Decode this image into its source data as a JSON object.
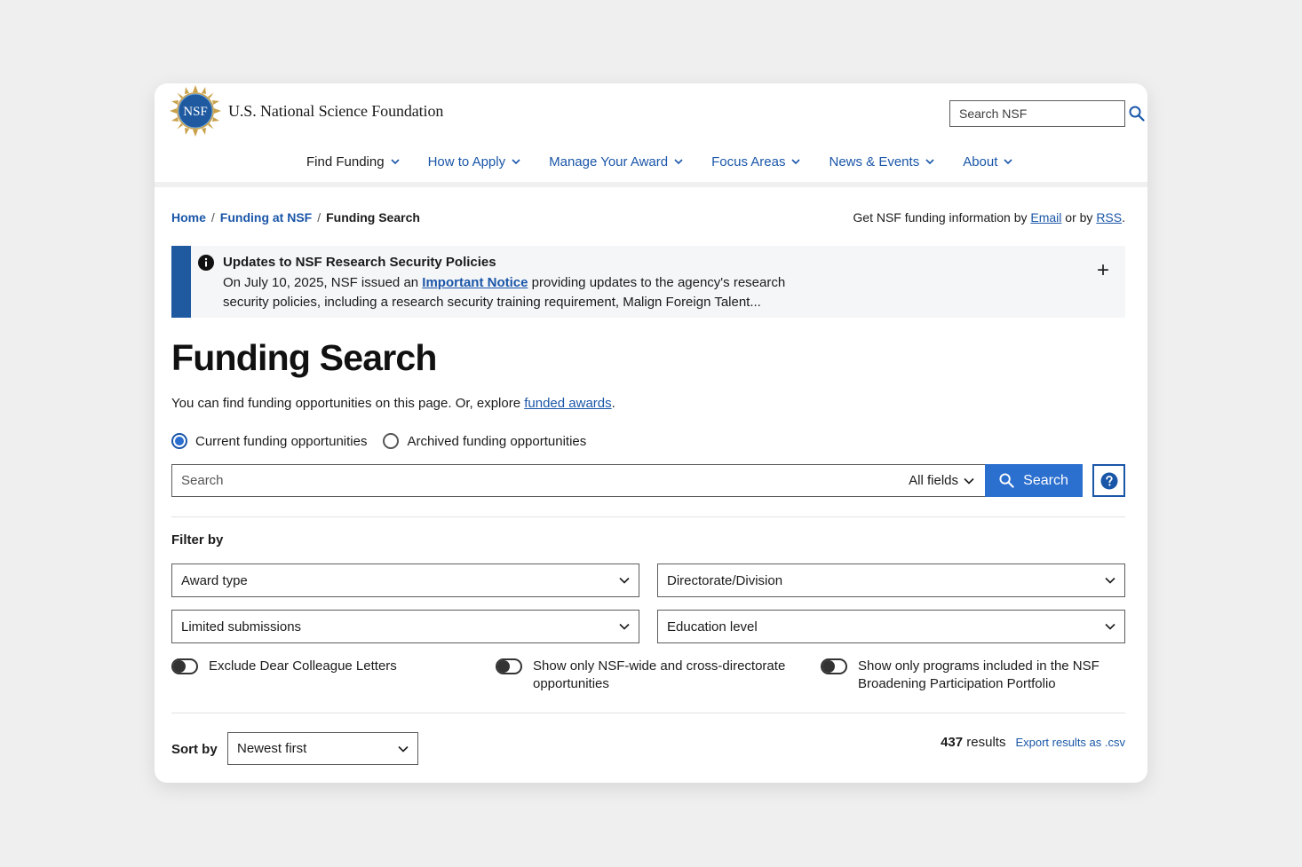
{
  "header": {
    "site_name": "U.S. National Science Foundation",
    "seal_text": "NSF",
    "search_placeholder": "Search NSF"
  },
  "nav": [
    {
      "label": "Find Funding",
      "active": true
    },
    {
      "label": "How to Apply"
    },
    {
      "label": "Manage Your Award"
    },
    {
      "label": "Focus Areas"
    },
    {
      "label": "News & Events"
    },
    {
      "label": "About"
    }
  ],
  "breadcrumb": {
    "items": [
      "Home",
      "Funding at NSF"
    ],
    "current": "Funding Search"
  },
  "subscribe": {
    "prefix": "Get NSF funding information by",
    "email_link": "Email",
    "middle": "or by",
    "rss_link": "RSS",
    "suffix": "."
  },
  "alert": {
    "title": "Updates to NSF Research Security Policies",
    "body_prefix": "On July 10, 2025, NSF issued an",
    "link": "Important Notice",
    "body_suffix": "providing updates to the agency's research security policies, including a research security training requirement, Malign Foreign Talent...",
    "expand": "+"
  },
  "page": {
    "title": "Funding Search",
    "intro_prefix": "You can find funding opportunities on this page. Or, explore",
    "intro_link": "funded awards",
    "intro_suffix": "."
  },
  "radios": [
    {
      "label": "Current funding opportunities",
      "checked": true
    },
    {
      "label": "Archived funding opportunities",
      "checked": false
    }
  ],
  "search": {
    "placeholder": "Search",
    "field_select": "All fields",
    "button": "Search"
  },
  "filters": {
    "label": "Filter by",
    "selects": [
      "Award type",
      "Directorate/Division",
      "Limited submissions",
      "Education level"
    ],
    "toggles": [
      "Exclude Dear Colleague Letters",
      "Show only NSF-wide and cross-directorate opportunities",
      "Show only programs included in the NSF Broadening Participation Portfolio"
    ]
  },
  "sort": {
    "label": "Sort by",
    "value": "Newest first"
  },
  "results": {
    "count": "437",
    "label": "results",
    "export": "Export results as .csv"
  },
  "colors": {
    "link": "#1a56a8",
    "primary_button": "#2b6fcf",
    "alert_bar": "#1f5aa0",
    "nav_active_underline": "#7aaee6"
  }
}
